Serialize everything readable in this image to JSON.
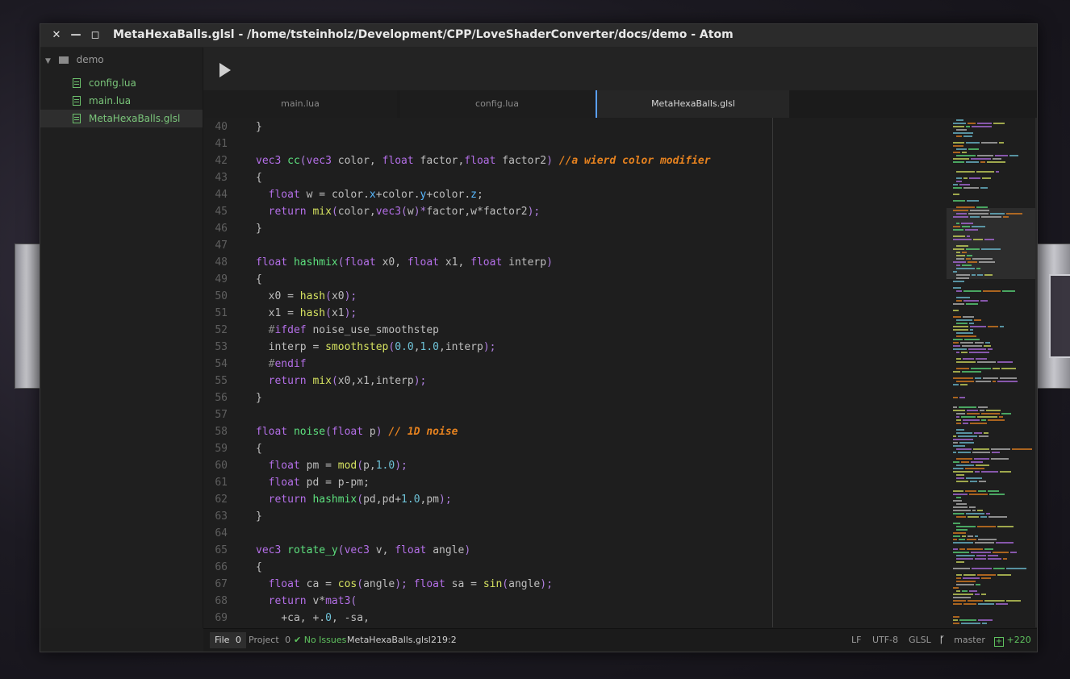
{
  "window": {
    "title": "MetaHexaBalls.glsl - /home/tsteinholz/Development/CPP/LoveShaderConverter/docs/demo - Atom"
  },
  "titlebar_buttons": {
    "close": "✕",
    "minimize": "—",
    "maximize": "◻"
  },
  "tree": {
    "root": "demo",
    "files": [
      {
        "name": "config.lua"
      },
      {
        "name": "main.lua"
      },
      {
        "name": "MetaHexaBalls.glsl",
        "selected": true
      }
    ]
  },
  "tabs": [
    {
      "label": "main.lua"
    },
    {
      "label": "config.lua"
    },
    {
      "label": "MetaHexaBalls.glsl",
      "active": true
    }
  ],
  "code": [
    {
      "n": "40",
      "t": "}"
    },
    {
      "n": "41",
      "t": ""
    },
    {
      "n": "42",
      "t": "vec3 cc(vec3 color, float factor,float factor2) //a wierd color modifier"
    },
    {
      "n": "43",
      "t": "{"
    },
    {
      "n": "44",
      "t": "  float w = color.x+color.y+color.z;"
    },
    {
      "n": "45",
      "t": "  return mix(color,vec3(w)*factor,w*factor2);"
    },
    {
      "n": "46",
      "t": "}"
    },
    {
      "n": "47",
      "t": ""
    },
    {
      "n": "48",
      "t": "float hashmix(float x0, float x1, float interp)"
    },
    {
      "n": "49",
      "t": "{"
    },
    {
      "n": "50",
      "t": "  x0 = hash(x0);"
    },
    {
      "n": "51",
      "t": "  x1 = hash(x1);"
    },
    {
      "n": "52",
      "t": "  #ifdef noise_use_smoothstep"
    },
    {
      "n": "53",
      "t": "  interp = smoothstep(0.0,1.0,interp);"
    },
    {
      "n": "54",
      "t": "  #endif"
    },
    {
      "n": "55",
      "t": "  return mix(x0,x1,interp);"
    },
    {
      "n": "56",
      "t": "}"
    },
    {
      "n": "57",
      "t": ""
    },
    {
      "n": "58",
      "t": "float noise(float p) // 1D noise"
    },
    {
      "n": "59",
      "t": "{"
    },
    {
      "n": "60",
      "t": "  float pm = mod(p,1.0);"
    },
    {
      "n": "61",
      "t": "  float pd = p-pm;"
    },
    {
      "n": "62",
      "t": "  return hashmix(pd,pd+1.0,pm);"
    },
    {
      "n": "63",
      "t": "}"
    },
    {
      "n": "64",
      "t": ""
    },
    {
      "n": "65",
      "t": "vec3 rotate_y(vec3 v, float angle)"
    },
    {
      "n": "66",
      "t": "{"
    },
    {
      "n": "67",
      "t": "  float ca = cos(angle); float sa = sin(angle);"
    },
    {
      "n": "68",
      "t": "  return v*mat3("
    },
    {
      "n": "69",
      "t": "    +ca, +.0, -sa,"
    }
  ],
  "status": {
    "file_label": "File",
    "file_count": "0",
    "project_label": "Project",
    "project_count": "0",
    "issues": "No Issues",
    "filename": "MetaHexaBalls.glsl",
    "cursor": "219:2",
    "line_ending": "LF",
    "encoding": "UTF-8",
    "grammar": "GLSL",
    "branch": "master",
    "diff": "+220"
  },
  "colors": {
    "accent": "#5aa0ff",
    "green": "#5fc35f",
    "keyword": "#b46fe8",
    "comment": "#e6821f"
  }
}
